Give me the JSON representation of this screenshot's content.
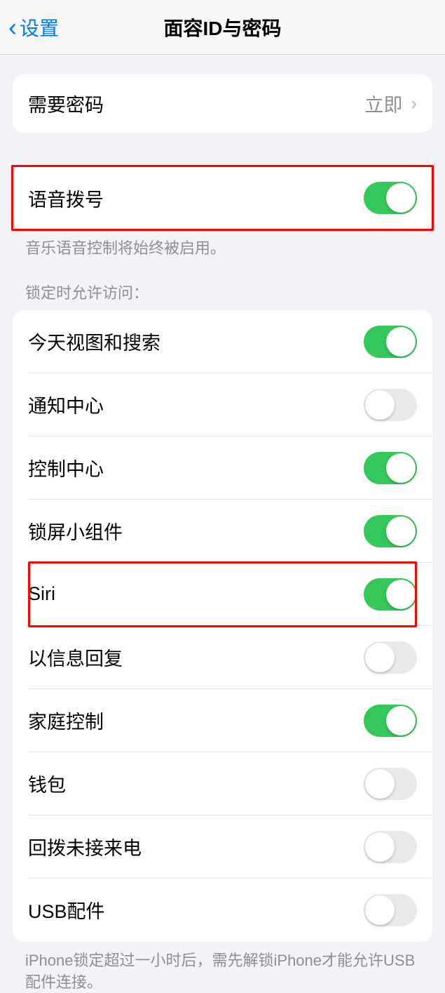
{
  "header": {
    "back_label": "设置",
    "title": "面容ID与密码"
  },
  "passcode_row": {
    "label": "需要密码",
    "value": "立即"
  },
  "voice_dial": {
    "label": "语音拨号",
    "on": true,
    "footer": "音乐语音控制将始终被启用。"
  },
  "locked_access": {
    "header": "锁定时允许访问：",
    "items": [
      {
        "label": "今天视图和搜索",
        "on": true
      },
      {
        "label": "通知中心",
        "on": false
      },
      {
        "label": "控制中心",
        "on": true
      },
      {
        "label": "锁屏小组件",
        "on": true
      },
      {
        "label": "Siri",
        "on": true
      },
      {
        "label": "以信息回复",
        "on": false
      },
      {
        "label": "家庭控制",
        "on": true
      },
      {
        "label": "钱包",
        "on": false
      },
      {
        "label": "回拨未接来电",
        "on": false
      },
      {
        "label": "USB配件",
        "on": false
      }
    ],
    "footer": "iPhone锁定超过一小时后，需先解锁iPhone才能允许USB配件连接。"
  }
}
